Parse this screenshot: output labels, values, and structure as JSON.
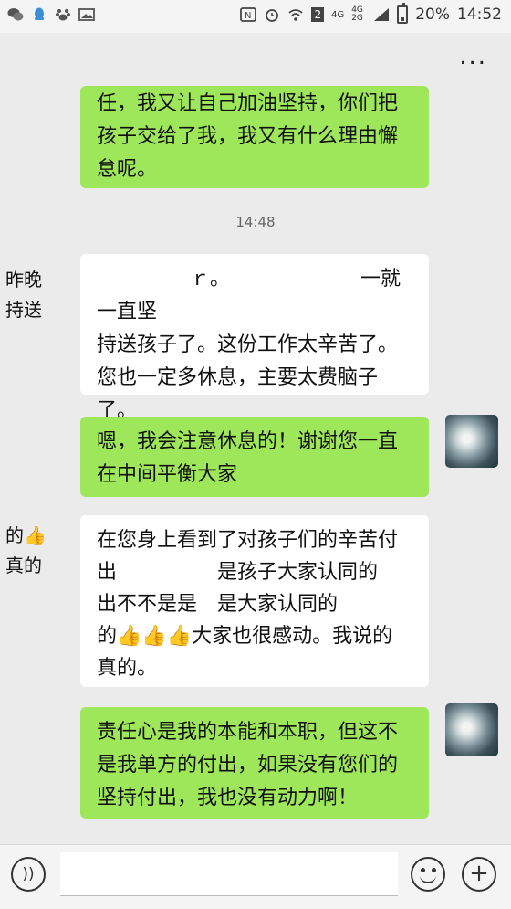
{
  "status_bar": {
    "sim_slot": "2",
    "network_1": "4G",
    "network_2": "4G 2G",
    "battery": "20%",
    "time": "14:52"
  },
  "header": {
    "more_label": "..."
  },
  "messages": [
    {
      "side": "me",
      "text": "任，我又让自己加油坚持，你们把\n孩子交给了我，我又有什么理由懈\n怠呢。"
    },
    {
      "side": "timestamp",
      "text": "14:48"
    },
    {
      "side": "other",
      "text": "  　　　　ｒ。　　　　　　　一就一直坚\n持送孩子了。这份工作太辛苦了。\n您也一定多休息，主要太费脑子了。\n体力到没啥，心操的太多了。"
    },
    {
      "side": "me",
      "text": "嗯，我会注意休息的！谢谢您一直\n在中间平衡大家"
    },
    {
      "side": "other",
      "text": "在您身上看到了对孩子们的辛苦付\n出　　　　　是孩子大家认同的\n出不不是是　是大家认同的\n的👍👍👍大家也很感动。我说的\n真的。"
    },
    {
      "side": "me",
      "text": "责任心是我的本能和本职，但这不\n是我单方的付出，如果没有您们的\n坚持付出，我也没有动力啊！"
    }
  ],
  "side_fragments": {
    "first": "昨晚\n持送",
    "second": "的👍\n真的"
  },
  "input_bar": {
    "voice_label": "))",
    "add_label": "+"
  }
}
